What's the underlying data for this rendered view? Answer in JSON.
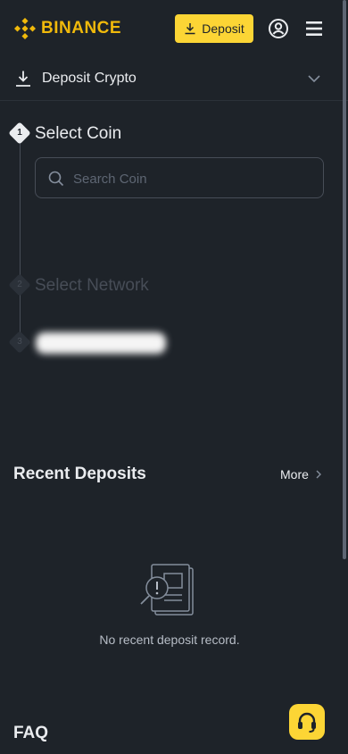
{
  "brand": {
    "name": "BINANCE",
    "accent": "#f0b90b",
    "button_yellow": "#fcd535"
  },
  "header": {
    "deposit_label": "Deposit"
  },
  "deposit_section": {
    "title": "Deposit Crypto"
  },
  "steps": [
    {
      "num": "1",
      "title": "Select Coin"
    },
    {
      "num": "2",
      "title": "Select Network"
    },
    {
      "num": "3"
    }
  ],
  "search": {
    "placeholder": "Search Coin"
  },
  "recent": {
    "title": "Recent Deposits",
    "more_label": "More",
    "empty_text": "No recent deposit record."
  },
  "faq": {
    "title": "FAQ"
  },
  "icons": [
    "binance-logo-icon",
    "download-icon",
    "user-icon",
    "menu-icon",
    "chevron-down-icon",
    "search-icon",
    "chevron-right-icon",
    "empty-record-icon",
    "headset-icon"
  ]
}
